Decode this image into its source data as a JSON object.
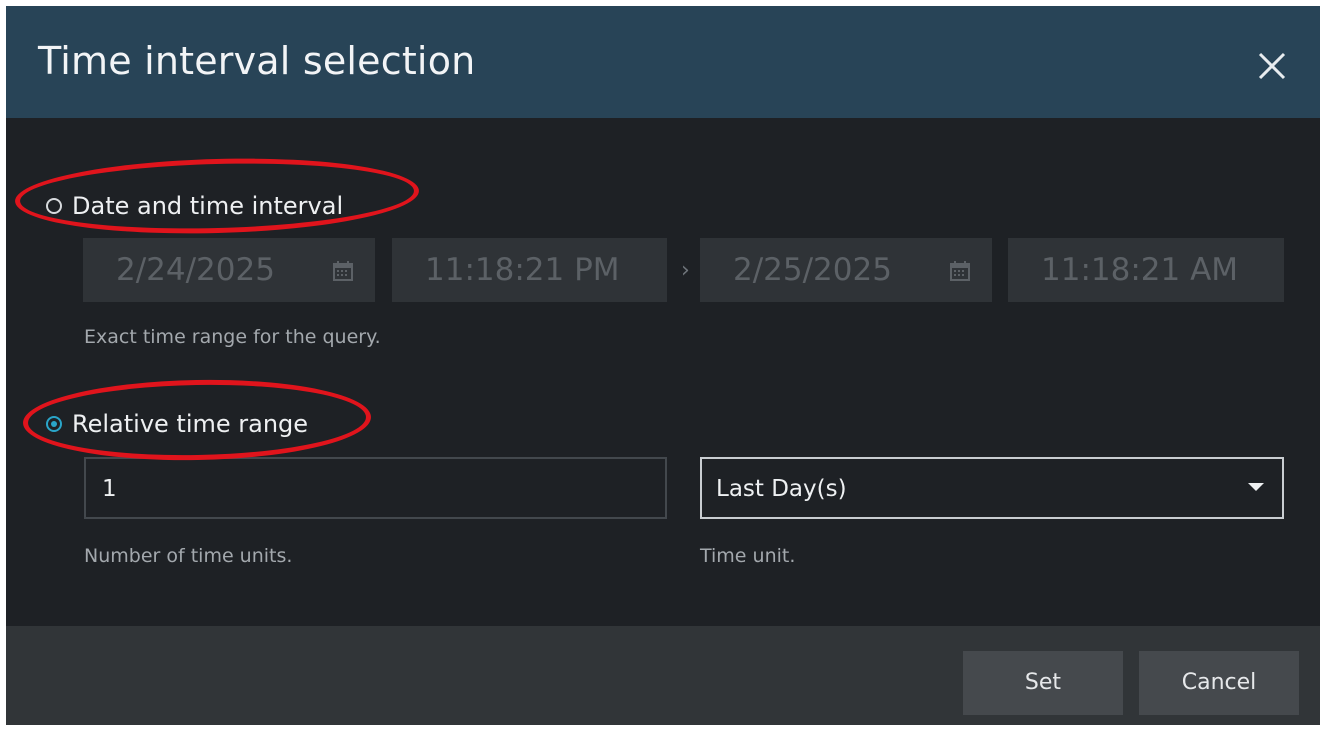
{
  "dialog": {
    "title": "Time interval selection",
    "close_icon": "close-icon"
  },
  "absolute": {
    "label": "Date and time interval",
    "selected": false,
    "start_date": "2/24/2025",
    "start_time": "11:18:21 PM",
    "separator": "›",
    "end_date": "2/25/2025",
    "end_time": "11:18:21 AM",
    "calendar_icon": "calendar-icon",
    "hint": "Exact time range for the query."
  },
  "relative": {
    "label": "Relative time range",
    "selected": true,
    "count_value": "1",
    "count_hint": "Number of time units.",
    "unit_value": "Last Day(s)",
    "unit_hint": "Time unit.",
    "dropdown_icon": "chevron-down-icon"
  },
  "footer": {
    "set_label": "Set",
    "cancel_label": "Cancel"
  },
  "colors": {
    "titlebar": "#284457",
    "body": "#1e2125",
    "footer": "#313538",
    "accent": "#2aa5c9",
    "annotation": "#e0141c"
  }
}
